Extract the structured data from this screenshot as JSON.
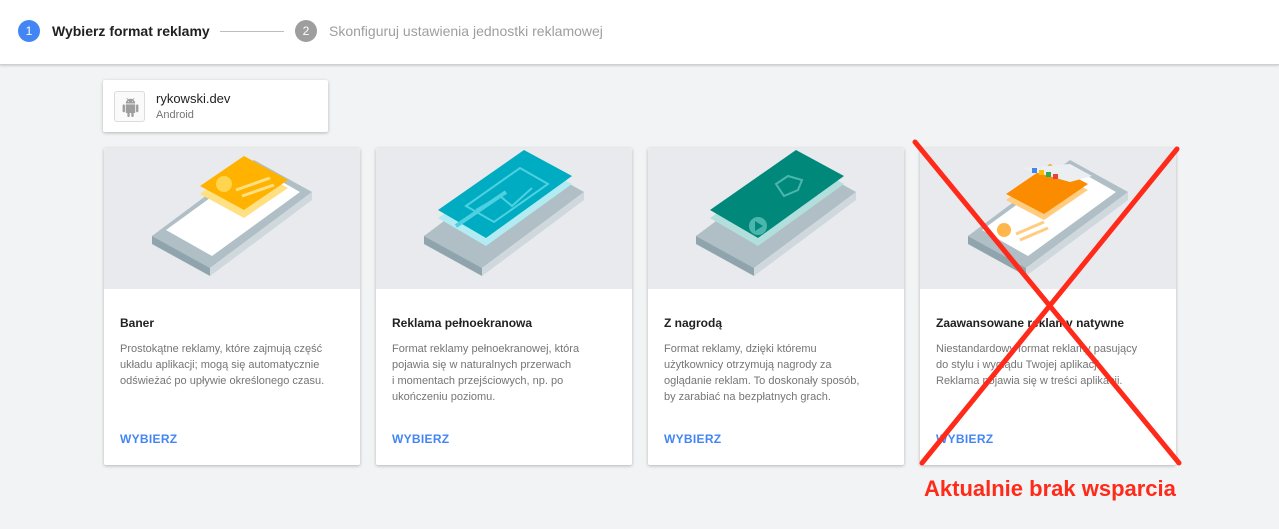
{
  "stepper": {
    "steps": [
      {
        "number": "1",
        "label": "Wybierz format reklamy"
      },
      {
        "number": "2",
        "label": "Skonfiguruj ustawienia jednostki reklamowej"
      }
    ]
  },
  "app": {
    "name": "rykowski.dev",
    "platform": "Android",
    "icon": "android-icon"
  },
  "cards": [
    {
      "title": "Baner",
      "description": "Prostokątne reklamy, które zajmują część\nukładu aplikacji; mogą się automatycznie\nodświeżać po upływie określonego czasu.",
      "action": "WYBIERZ",
      "illustration": "banner-ad-illustration"
    },
    {
      "title": "Reklama pełnoekranowa",
      "description": "Format reklamy pełnoekranowej, która\npojawia się w naturalnych przerwach\ni momentach przejściowych, np. po\nukończeniu poziomu.",
      "action": "WYBIERZ",
      "illustration": "interstitial-ad-illustration"
    },
    {
      "title": "Z nagrodą",
      "description": "Format reklamy, dzięki któremu\nużytkownicy otrzymują nagrody za\noglądanie reklam. To doskonały sposób,\nby zarabiać na bezpłatnych grach.",
      "action": "WYBIERZ",
      "illustration": "rewarded-ad-illustration"
    },
    {
      "title": "Zaawansowane reklamy natywne",
      "description": "Niestandardowy format reklamy pasujący\ndo stylu i wyglądu Twojej aplikacji.\nReklama pojawia się w treści aplikacji.",
      "action": "WYBIERZ",
      "illustration": "native-ad-illustration"
    }
  ],
  "annotation": {
    "text": "Aktualnie brak wsparcia",
    "color": "#ff2a1a"
  },
  "colors": {
    "accent": "#4285f4",
    "inactive_step": "#9e9e9e"
  }
}
